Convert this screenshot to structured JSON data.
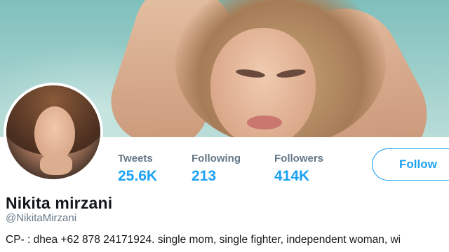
{
  "profile": {
    "name": "Nikita mirzani",
    "handle": "@NikitaMirzani",
    "bio": "CP- : dhea +62 878 24171924. single mom, single fighter, independent woman, wi"
  },
  "stats": {
    "tweets": {
      "label": "Tweets",
      "value": "25.6K"
    },
    "following": {
      "label": "Following",
      "value": "213"
    },
    "followers": {
      "label": "Followers",
      "value": "414K"
    }
  },
  "actions": {
    "follow_label": "Follow"
  },
  "colors": {
    "accent": "#1da1f2",
    "muted_text": "#657786",
    "primary_text": "#14171a"
  }
}
